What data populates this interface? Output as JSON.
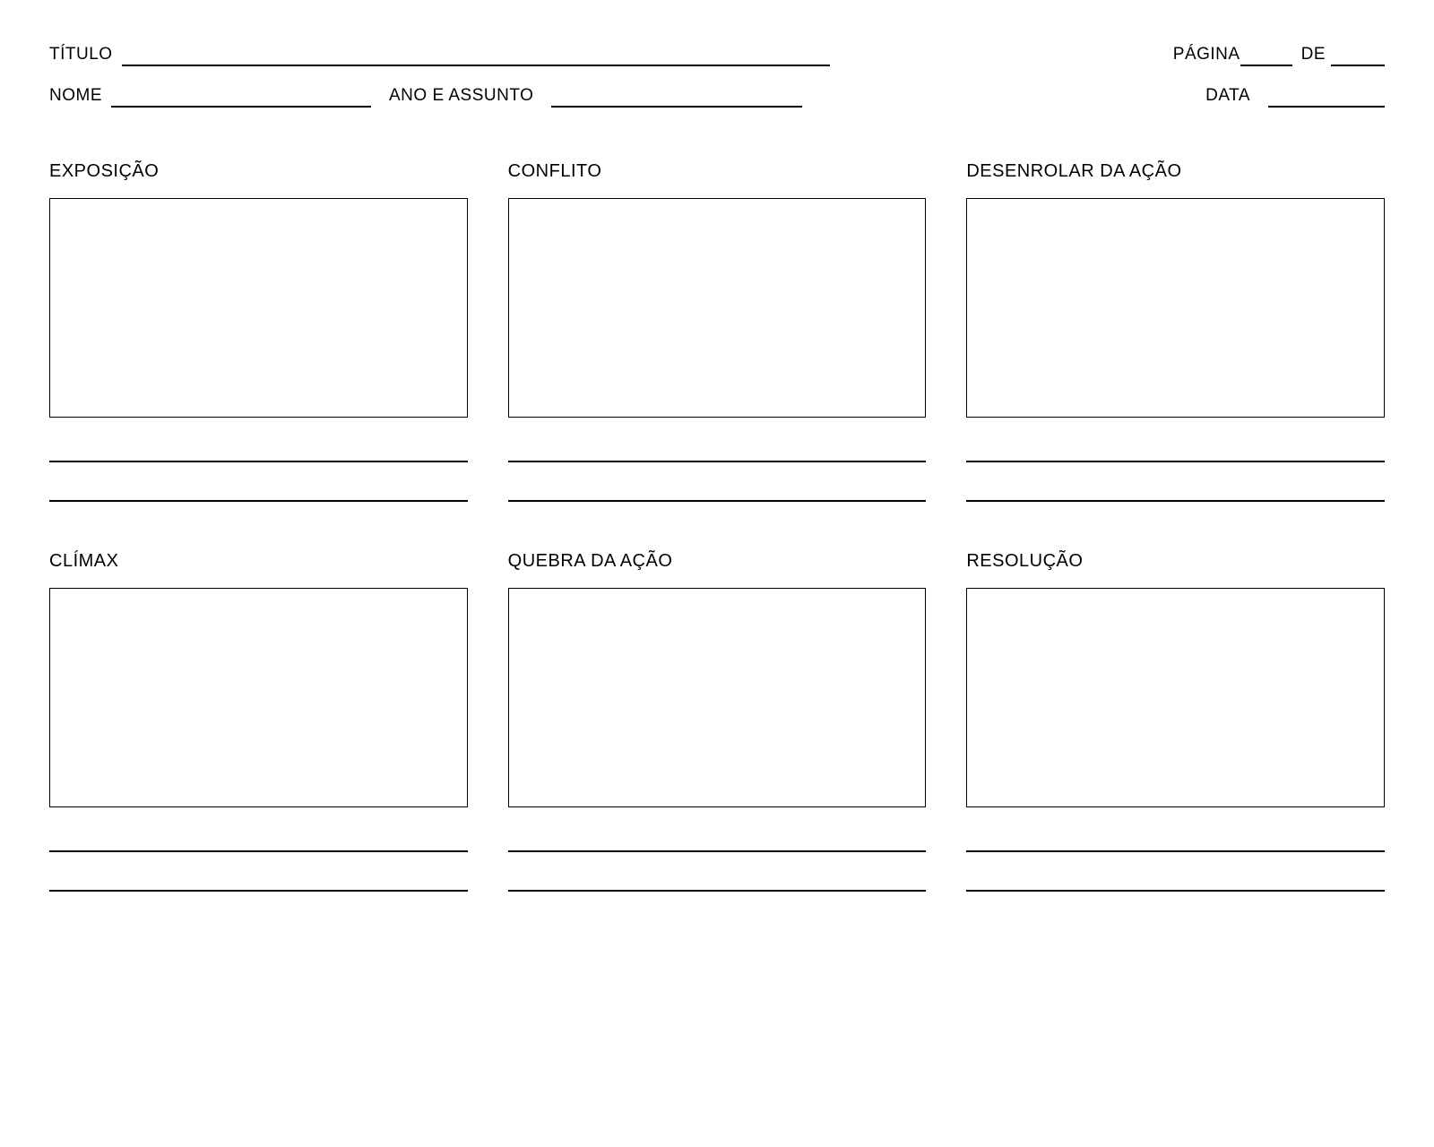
{
  "header": {
    "titulo_label": "TÍTULO",
    "pagina_label": "PÁGINA",
    "de_label": "DE",
    "nome_label": "NOME",
    "ano_assunto_label": "ANO E ASSUNTO",
    "data_label": "DATA"
  },
  "panels": [
    {
      "title": "EXPOSIÇÃO"
    },
    {
      "title": "CONFLITO"
    },
    {
      "title": "DESENROLAR DA AÇÃO"
    },
    {
      "title": "CLÍMAX"
    },
    {
      "title": "QUEBRA DA AÇÃO"
    },
    {
      "title": "RESOLUÇÃO"
    }
  ]
}
